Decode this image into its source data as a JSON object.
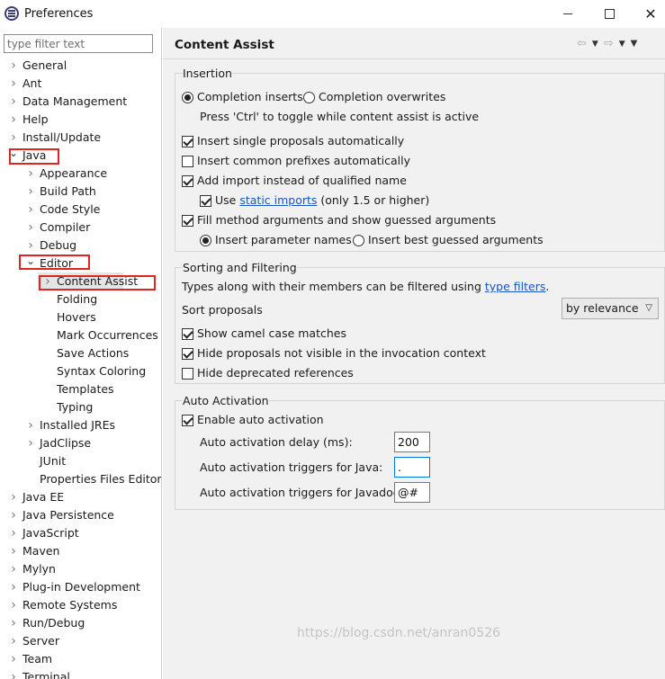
{
  "window": {
    "title": "Preferences",
    "close_glyph": "✕"
  },
  "filter": {
    "placeholder": "type filter text"
  },
  "tree": {
    "items": [
      {
        "label": "General"
      },
      {
        "label": "Ant"
      },
      {
        "label": "Data Management"
      },
      {
        "label": "Help"
      },
      {
        "label": "Install/Update"
      },
      {
        "label": "Java"
      },
      {
        "label": "Appearance"
      },
      {
        "label": "Build Path"
      },
      {
        "label": "Code Style"
      },
      {
        "label": "Compiler"
      },
      {
        "label": "Debug"
      },
      {
        "label": "Editor"
      },
      {
        "label": "Content Assist"
      },
      {
        "label": "Folding"
      },
      {
        "label": "Hovers"
      },
      {
        "label": "Mark Occurrences"
      },
      {
        "label": "Save Actions"
      },
      {
        "label": "Syntax Coloring"
      },
      {
        "label": "Templates"
      },
      {
        "label": "Typing"
      },
      {
        "label": "Installed JREs"
      },
      {
        "label": "JadClipse"
      },
      {
        "label": "JUnit"
      },
      {
        "label": "Properties Files Editor"
      },
      {
        "label": "Java EE"
      },
      {
        "label": "Java Persistence"
      },
      {
        "label": "JavaScript"
      },
      {
        "label": "Maven"
      },
      {
        "label": "Mylyn"
      },
      {
        "label": "Plug-in Development"
      },
      {
        "label": "Remote Systems"
      },
      {
        "label": "Run/Debug"
      },
      {
        "label": "Server"
      },
      {
        "label": "Team"
      },
      {
        "label": "Terminal"
      }
    ]
  },
  "page": {
    "title": "Content Assist"
  },
  "insertion": {
    "title": "Insertion",
    "completion_inserts": "Completion inserts",
    "completion_overwrites": "Completion overwrites",
    "toggle_hint": "Press 'Ctrl' to toggle while content assist is active",
    "insert_single": "Insert single proposals automatically",
    "insert_common": "Insert common prefixes automatically",
    "add_import": "Add import instead of qualified name",
    "use_prefix": "Use",
    "static_imports": "static imports",
    "use_suffix": "(only 1.5 or higher)",
    "fill_method": "Fill method arguments and show guessed arguments",
    "insert_param_names": "Insert parameter names",
    "insert_best_guessed": "Insert best guessed arguments"
  },
  "sorting": {
    "title": "Sorting and Filtering",
    "desc_prefix": "Types along with their members can be filtered using",
    "type_filters": "type filters",
    "desc_suffix": ".",
    "sort_label": "Sort proposals",
    "sort_value": "by relevance",
    "camel": "Show camel case matches",
    "hide_invisible": "Hide proposals not visible in the invocation context",
    "hide_deprecated": "Hide deprecated references"
  },
  "auto_activation": {
    "title": "Auto Activation",
    "enable": "Enable auto activation",
    "delay_label": "Auto activation delay (ms):",
    "delay_value": "200",
    "java_label": "Auto activation triggers for Java:",
    "java_value": ".",
    "javadoc_label": "Auto activation triggers for Javadoc:",
    "javadoc_value": "@#"
  },
  "watermark": "https://blog.csdn.net/anran0526"
}
